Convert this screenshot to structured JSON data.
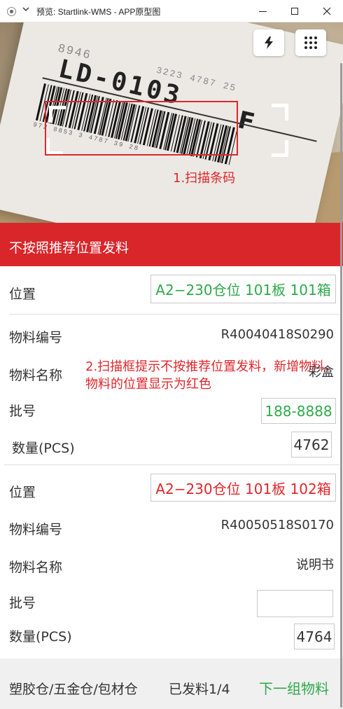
{
  "window": {
    "title": "预览: Startlink-WMS - APP原型图",
    "icons": [
      "radio-icon",
      "chevron-down-icon",
      "minimize-icon",
      "maximize-icon",
      "close-icon"
    ]
  },
  "camera": {
    "label_code": "LD-0103",
    "label_number_1": "8946",
    "label_number_2": "3223 4787 25",
    "label_letter": "F",
    "label_small_digits": "972  8853  3  4787  39  28",
    "scan_tip": "1.扫描条码",
    "flash_icon": "flash-icon",
    "menu_icon": "grid-dots-icon"
  },
  "banner": {
    "text": "不按照推荐位置发料",
    "color": "#d9262b"
  },
  "annotation": {
    "text": "2.扫描框提示不按推荐位置发料，新增物料，物料的位置显示为红色"
  },
  "labels": {
    "location": "位置",
    "material_code": "物料编号",
    "material_name": "物料名称",
    "batch": "批号",
    "qty": "数量(PCS)"
  },
  "items": [
    {
      "location": "A2−230仓位 101板 101箱",
      "location_color": "#2ea94b",
      "material_code": "R40040418S0290",
      "material_name": "彩盒",
      "batch": "188-8888",
      "qty": "4762"
    },
    {
      "location": "A2−230仓位 101板 102箱",
      "location_color": "#e0262b",
      "material_code": "R40050518S0170",
      "material_name": "说明书",
      "batch": "",
      "qty": "4764"
    }
  ],
  "footer": {
    "warehouse": "塑胶仓/五金仓/包材仓",
    "progress": "已发料1/4",
    "next_button": "下一组物料",
    "next_color": "#2ea94b"
  }
}
